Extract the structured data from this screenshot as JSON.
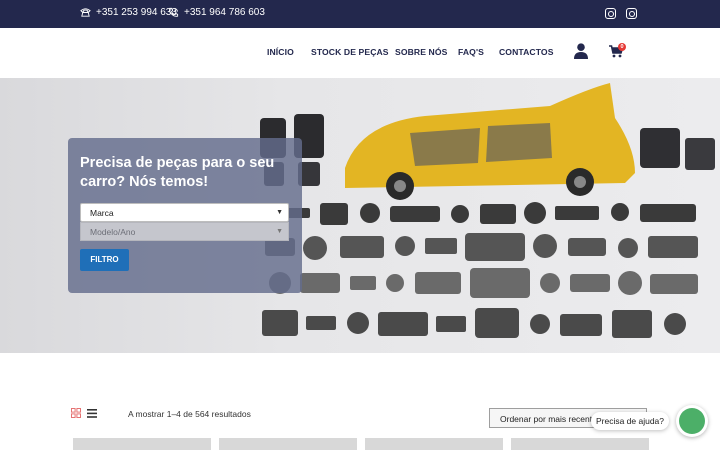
{
  "topbar": {
    "phones": [
      "+351 253 994 633",
      "+351 964 786 603"
    ],
    "social": [
      "facebook-icon",
      "instagram-icon"
    ]
  },
  "nav": {
    "items": [
      "INÍCIO",
      "STOCK DE PEÇAS",
      "SOBRE NÓS",
      "FAQ'S",
      "CONTACTOS"
    ],
    "cart_count": "0"
  },
  "hero": {
    "title": "Precisa de peças para o seu carro? Nós temos!",
    "brand_select": "Marca",
    "model_placeholder": "Modelo/Ano",
    "filter_button": "FILTRO"
  },
  "shop": {
    "results_text": "A mostrar 1–4 de 564 resultados",
    "sort_value": "Ordenar por mais recentes"
  },
  "chat": {
    "prompt": "Precisa de ajuda?"
  },
  "colors": {
    "navy": "#23284d",
    "accent_blue": "#1f6fb8",
    "car_yellow": "#e3b523",
    "chat_green": "#4caf68"
  }
}
